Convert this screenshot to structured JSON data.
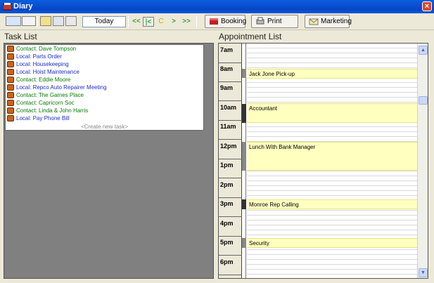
{
  "window": {
    "title": "Diary",
    "close_label": "×"
  },
  "toolbar": {
    "today_label": "Today",
    "booking_label": "Booking",
    "print_label": "Print",
    "marketing_label": "Marketing",
    "nav": [
      "<<",
      "|<",
      "C",
      ">",
      ">>"
    ]
  },
  "task_list": {
    "header": "Task List",
    "tasks": [
      {
        "type": "contact",
        "label": "Contact: Dave Tompson"
      },
      {
        "type": "local",
        "label": "Local: Parts Order"
      },
      {
        "type": "local",
        "label": "Local: Housekeeping"
      },
      {
        "type": "local",
        "label": "Local: Hoist Maintenance"
      },
      {
        "type": "contact",
        "label": "Contact: Eddie Moore"
      },
      {
        "type": "local",
        "label": "Local: Repco Auto Repairer Meeting"
      },
      {
        "type": "contact",
        "label": "Contact: The Games Place"
      },
      {
        "type": "contact",
        "label": "Contact: Capricorn Soc"
      },
      {
        "type": "contact",
        "label": "Contact: Linda & John Harris"
      },
      {
        "type": "local",
        "label": "Local: Pay Phone Bill"
      }
    ],
    "new_task_label": "<Create new task>"
  },
  "appointment_list": {
    "header": "Appointment List",
    "hours": [
      "7am",
      "8am",
      "9am",
      "10am",
      "11am",
      "12pm",
      "1pm",
      "2pm",
      "3pm",
      "4pm",
      "5pm",
      "6pm"
    ],
    "appointments": [
      {
        "label": "Jack Jone Pick-up"
      },
      {
        "label": "Accountant"
      },
      {
        "label": "Lunch With Bank Manager"
      },
      {
        "label": "Monroe Rep Calling"
      },
      {
        "label": "Security"
      }
    ]
  }
}
